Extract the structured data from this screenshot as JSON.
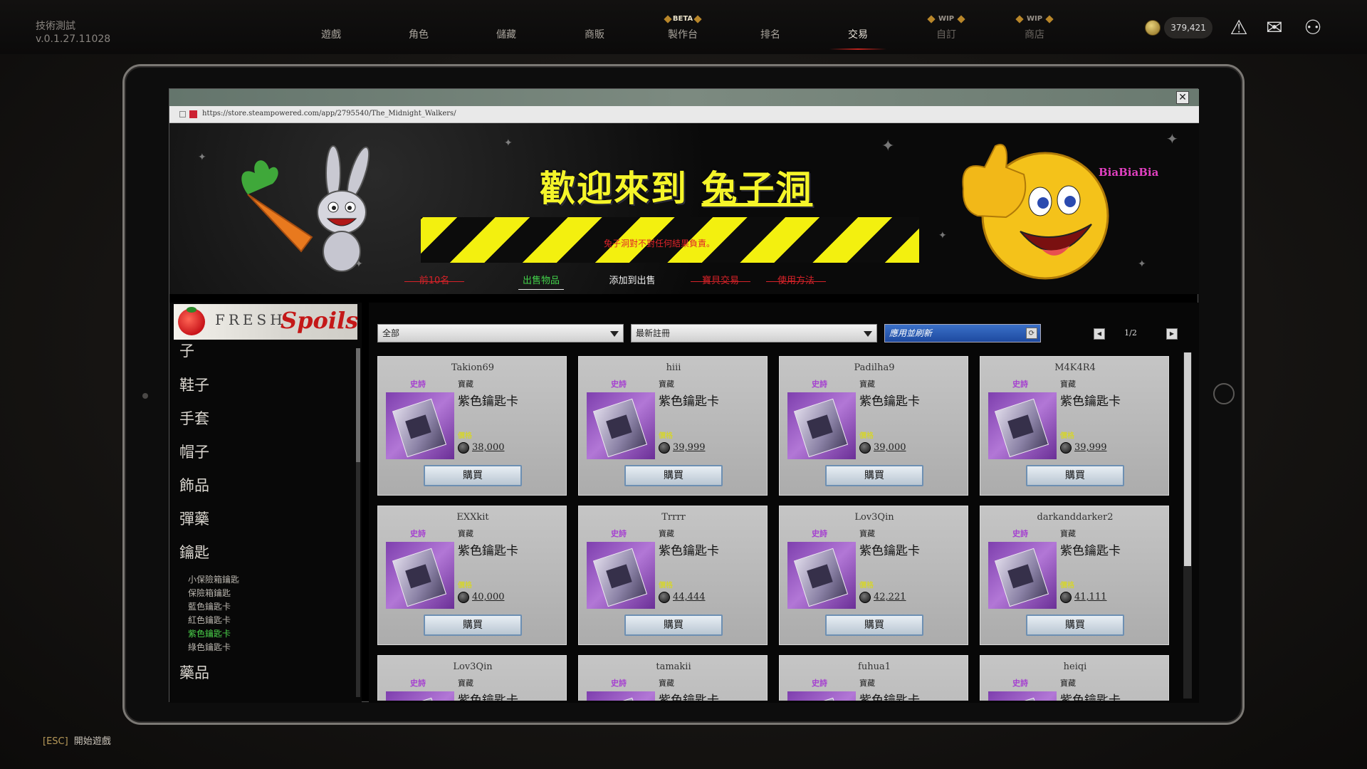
{
  "game": {
    "test_label": "技術測試",
    "version": "v.0.1.27.11028"
  },
  "nav": {
    "items": [
      {
        "label": "遊戲",
        "tag": ""
      },
      {
        "label": "角色",
        "tag": ""
      },
      {
        "label": "儲藏",
        "tag": ""
      },
      {
        "label": "商販",
        "tag": ""
      },
      {
        "label": "製作台",
        "tag": "BETA"
      },
      {
        "label": "排名",
        "tag": ""
      },
      {
        "label": "交易",
        "tag": ""
      },
      {
        "label": "自訂",
        "tag": "WIP"
      },
      {
        "label": "商店",
        "tag": "WIP"
      }
    ],
    "active": "交易",
    "gold": "379,421"
  },
  "browser": {
    "url": "https://store.steampowered.com/app/2795540/The_Midnight_Walkers/",
    "close_label": "✕"
  },
  "banner": {
    "welcome_prefix": "歡迎來到 ",
    "welcome_name": "兔子洞",
    "disclaimer": "兔子洞對不對任何結果負責。",
    "corner_text": "BiaBiaBia",
    "links": [
      "前10名",
      "出售物品",
      "添加到出售",
      "寶貝交易",
      "使用方法"
    ]
  },
  "sidebar": {
    "logo_fresh": "FRESH",
    "logo_spoils": "Spoils",
    "categories": [
      "子",
      "鞋子",
      "手套",
      "帽子",
      "飾品",
      "彈藥",
      "鑰匙"
    ],
    "subitems": [
      "小保險箱鑰匙",
      "保險箱鑰匙",
      "藍色鑰匙卡",
      "紅色鑰匙卡",
      "紫色鑰匙卡",
      "綠色鑰匙卡"
    ],
    "selected_sub": "紫色鑰匙卡",
    "last_category": "藥品"
  },
  "market": {
    "filter_category": "全部",
    "filter_sort": "最新註冊",
    "apply_label": "應用並刷新",
    "page": "1/2",
    "price_label": "價格",
    "buy_label": "購買",
    "listings": [
      {
        "seller": "Takion69",
        "rarity": "史詩",
        "type": "寶藏",
        "item": "紫色鑰匙卡",
        "price": "38,000"
      },
      {
        "seller": "hiii",
        "rarity": "史詩",
        "type": "寶藏",
        "item": "紫色鑰匙卡",
        "price": "39,999"
      },
      {
        "seller": "Padilha9",
        "rarity": "史詩",
        "type": "寶藏",
        "item": "紫色鑰匙卡",
        "price": "39,000"
      },
      {
        "seller": "M4K4R4",
        "rarity": "史詩",
        "type": "寶藏",
        "item": "紫色鑰匙卡",
        "price": "39,999"
      },
      {
        "seller": "EXXkit",
        "rarity": "史詩",
        "type": "寶藏",
        "item": "紫色鑰匙卡",
        "price": "40,000"
      },
      {
        "seller": "Trrrr",
        "rarity": "史詩",
        "type": "寶藏",
        "item": "紫色鑰匙卡",
        "price": "44,444"
      },
      {
        "seller": "Lov3Qin",
        "rarity": "史詩",
        "type": "寶藏",
        "item": "紫色鑰匙卡",
        "price": "42,221"
      },
      {
        "seller": "darkanddarker2",
        "rarity": "史詩",
        "type": "寶藏",
        "item": "紫色鑰匙卡",
        "price": "41,111"
      },
      {
        "seller": "Lov3Qin",
        "rarity": "史詩",
        "type": "寶藏",
        "item": "紫色鑰匙卡",
        "price": ""
      },
      {
        "seller": "tamakii",
        "rarity": "史詩",
        "type": "寶藏",
        "item": "紫色鑰匙卡",
        "price": ""
      },
      {
        "seller": "fuhua1",
        "rarity": "史詩",
        "type": "寶藏",
        "item": "紫色鑰匙卡",
        "price": ""
      },
      {
        "seller": "heiqi",
        "rarity": "史詩",
        "type": "寶藏",
        "item": "紫色鑰匙卡",
        "price": ""
      }
    ]
  },
  "footer": {
    "esc_key": "[ESC]",
    "esc_label": "開始遊戲"
  }
}
